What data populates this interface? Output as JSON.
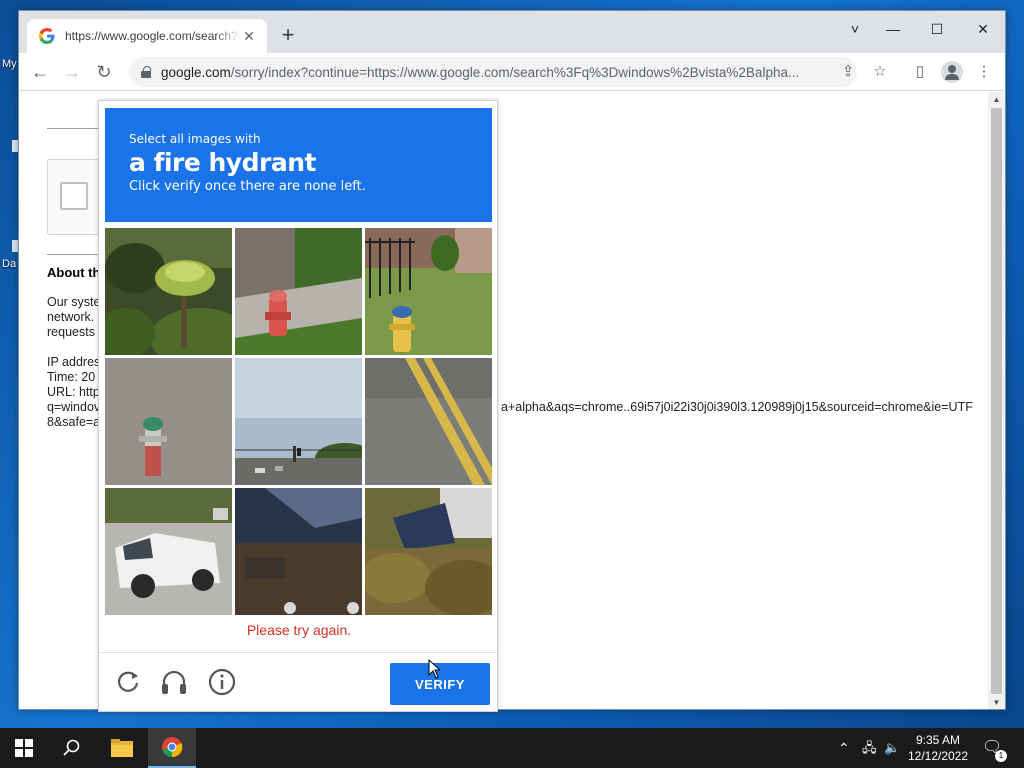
{
  "desktop": {
    "labels": [
      "My",
      "Da"
    ]
  },
  "browser": {
    "tab": {
      "title": "https://www.google.com/search?q=windows+vista+alpha",
      "favicon": "google-g-icon"
    },
    "window_controls": {
      "tab_search": "˅",
      "minimize": "—",
      "maximize": "☐",
      "close": "✕"
    },
    "address": {
      "host": "google.com",
      "path": "/sorry/index?continue=https://www.google.com/search%3Fq%3Dwindows%2Bvista%2Balpha..."
    }
  },
  "page": {
    "about_heading": "About th",
    "paragraph_lines": [
      "Our syste",
      "network.",
      "requests"
    ],
    "ip_line": "IP addres",
    "time_line": "Time: 20",
    "url_line": "URL: http",
    "q_line": "q=windov",
    "safe_line": "8&safe=a",
    "url_tail": "a+alpha&aqs=chrome..69i57j0i22i30j0i390l3.120989j0j15&sourceid=chrome&ie=UTF"
  },
  "captcha": {
    "instruction_small": "Select all images with",
    "target": "a fire hydrant",
    "instruction_sub": "Click verify once there are none left.",
    "tiles": [
      {
        "id": 1,
        "content": "palm shrub"
      },
      {
        "id": 2,
        "content": "red fire hydrant"
      },
      {
        "id": 3,
        "content": "yellow fire hydrant"
      },
      {
        "id": 4,
        "content": "fire hydrant on asphalt"
      },
      {
        "id": 5,
        "content": "road with traffic lights"
      },
      {
        "id": 6,
        "content": "road with yellow lines"
      },
      {
        "id": 7,
        "content": "white pickup truck"
      },
      {
        "id": 8,
        "content": "dark building"
      },
      {
        "id": 9,
        "content": "car in bushes"
      }
    ],
    "error": "Please try again.",
    "verify_label": "VERIFY",
    "footer_icons": [
      "reload-icon",
      "headphones-icon",
      "info-icon"
    ]
  },
  "taskbar": {
    "time": "9:35 AM",
    "date": "12/12/2022",
    "notification_count": "1"
  },
  "colors": {
    "captcha_blue": "#1a73e8",
    "error_red": "#d93025",
    "chrome_tabstrip": "#dee1e6"
  }
}
